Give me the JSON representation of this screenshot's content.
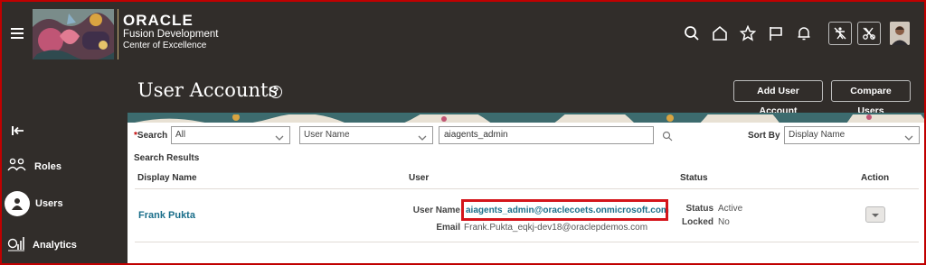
{
  "brand": {
    "oracle": "ORACLE",
    "line1": "Fusion Development",
    "line2": "Center of Excellence"
  },
  "header_icons": [
    "search-icon",
    "home-icon",
    "star-icon",
    "flag-icon",
    "bell-icon",
    "accessibility-off-icon",
    "scissors-off-icon",
    "user-avatar"
  ],
  "page": {
    "title": "User Accounts",
    "help": "?",
    "add_user_account": "Add User Account",
    "compare_users": "Compare Users"
  },
  "sidebar": {
    "items": [
      {
        "label": "Roles",
        "icon": "roles-icon"
      },
      {
        "label": "Users",
        "icon": "users-icon",
        "selected": true
      },
      {
        "label": "Analytics",
        "icon": "analytics-icon"
      }
    ]
  },
  "search": {
    "required_mark": "*",
    "label": "Search",
    "scope_value": "All",
    "field_value": "User Name",
    "query_value": "aiagents_admin",
    "sort_label": "Sort By",
    "sort_value": "Display Name",
    "results_label": "Search Results"
  },
  "table": {
    "headers": {
      "display_name": "Display Name",
      "user": "User",
      "status": "Status",
      "action": "Action"
    },
    "rows": [
      {
        "display_name": "Frank Pukta",
        "user_name_label": "User Name",
        "user_name": "aiagents_admin@oraclecoets.onmicrosoft.com",
        "email_label": "Email",
        "email": "Frank.Pukta_eqkj-dev18@oraclepdemos.com",
        "status_label": "Status",
        "status": "Active",
        "locked_label": "Locked",
        "locked": "No"
      }
    ]
  },
  "colors": {
    "header_bg": "#312d2a",
    "link": "#1a6e8a",
    "highlight": "#d4151b"
  }
}
